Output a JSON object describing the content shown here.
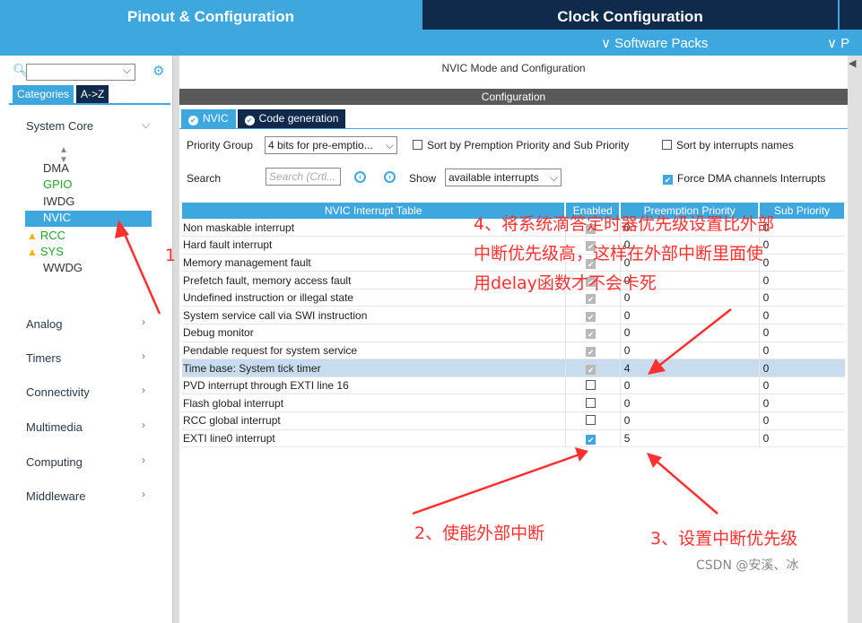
{
  "top_tabs": {
    "pinout": "Pinout & Configuration",
    "clock": "Clock Configuration"
  },
  "subbar": {
    "software_packs": "∨ Software Packs",
    "more": "∨ P"
  },
  "left": {
    "categories_tab": "Categories",
    "az_tab": "A->Z",
    "system_core": "System Core",
    "core_items": [
      "DMA",
      "GPIO",
      "IWDG",
      "NVIC",
      "RCC",
      "SYS",
      "WWDG"
    ],
    "sections": [
      "Analog",
      "Timers",
      "Connectivity",
      "Multimedia",
      "Computing",
      "Middleware"
    ]
  },
  "main": {
    "mode_title": "NVIC Mode and Configuration",
    "config_title": "Configuration",
    "tab_nvic": "NVIC",
    "tab_code": "Code generation",
    "priority_group_label": "Priority Group",
    "priority_group_value": "4 bits for pre-emptio...",
    "sort_premption": "Sort by Premption Priority and Sub Priority",
    "sort_names": "Sort by interrupts names",
    "search_label": "Search",
    "search_placeholder": "Search (Crtl...",
    "show_label": "Show",
    "show_value": "available interrupts",
    "force_dma": "Force DMA channels Interrupts"
  },
  "table": {
    "headers": [
      "NVIC Interrupt Table",
      "Enabled",
      "Preemption Priority",
      "Sub Priority"
    ],
    "rows": [
      {
        "name": "Non maskable interrupt",
        "enabled": "grey",
        "pre": "0",
        "sub": "0"
      },
      {
        "name": "Hard fault interrupt",
        "enabled": "grey",
        "pre": "0",
        "sub": "0"
      },
      {
        "name": "Memory management fault",
        "enabled": "grey",
        "pre": "0",
        "sub": "0"
      },
      {
        "name": "Prefetch fault, memory access fault",
        "enabled": "grey",
        "pre": "0",
        "sub": "0"
      },
      {
        "name": "Undefined instruction or illegal state",
        "enabled": "grey",
        "pre": "0",
        "sub": "0"
      },
      {
        "name": "System service call via SWI instruction",
        "enabled": "grey",
        "pre": "0",
        "sub": "0"
      },
      {
        "name": "Debug monitor",
        "enabled": "grey",
        "pre": "0",
        "sub": "0"
      },
      {
        "name": "Pendable request for system service",
        "enabled": "grey",
        "pre": "0",
        "sub": "0"
      },
      {
        "name": "Time base: System tick timer",
        "enabled": "grey",
        "pre": "4",
        "sub": "0"
      },
      {
        "name": "PVD interrupt through EXTI line 16",
        "enabled": "off",
        "pre": "0",
        "sub": "0"
      },
      {
        "name": "Flash global interrupt",
        "enabled": "off",
        "pre": "0",
        "sub": "0"
      },
      {
        "name": "RCC global interrupt",
        "enabled": "off",
        "pre": "0",
        "sub": "0"
      },
      {
        "name": "EXTI line0 interrupt",
        "enabled": "on",
        "pre": "5",
        "sub": "0"
      }
    ]
  },
  "annotations": {
    "a1": "1",
    "a4_line1": "4、将系统滴答定时器优先级设置比外部",
    "a4_line2": "中断优先级高，这样在外部中断里面使",
    "a4_line3": "用delay函数才不会卡死",
    "a2": "2、使能外部中断",
    "a3": "3、设置中断优先级",
    "watermark": "CSDN @安溪、冰"
  },
  "colors": {
    "accent": "#3ea7dd",
    "dark": "#0f2a4a",
    "annotation": "#ff3030"
  }
}
